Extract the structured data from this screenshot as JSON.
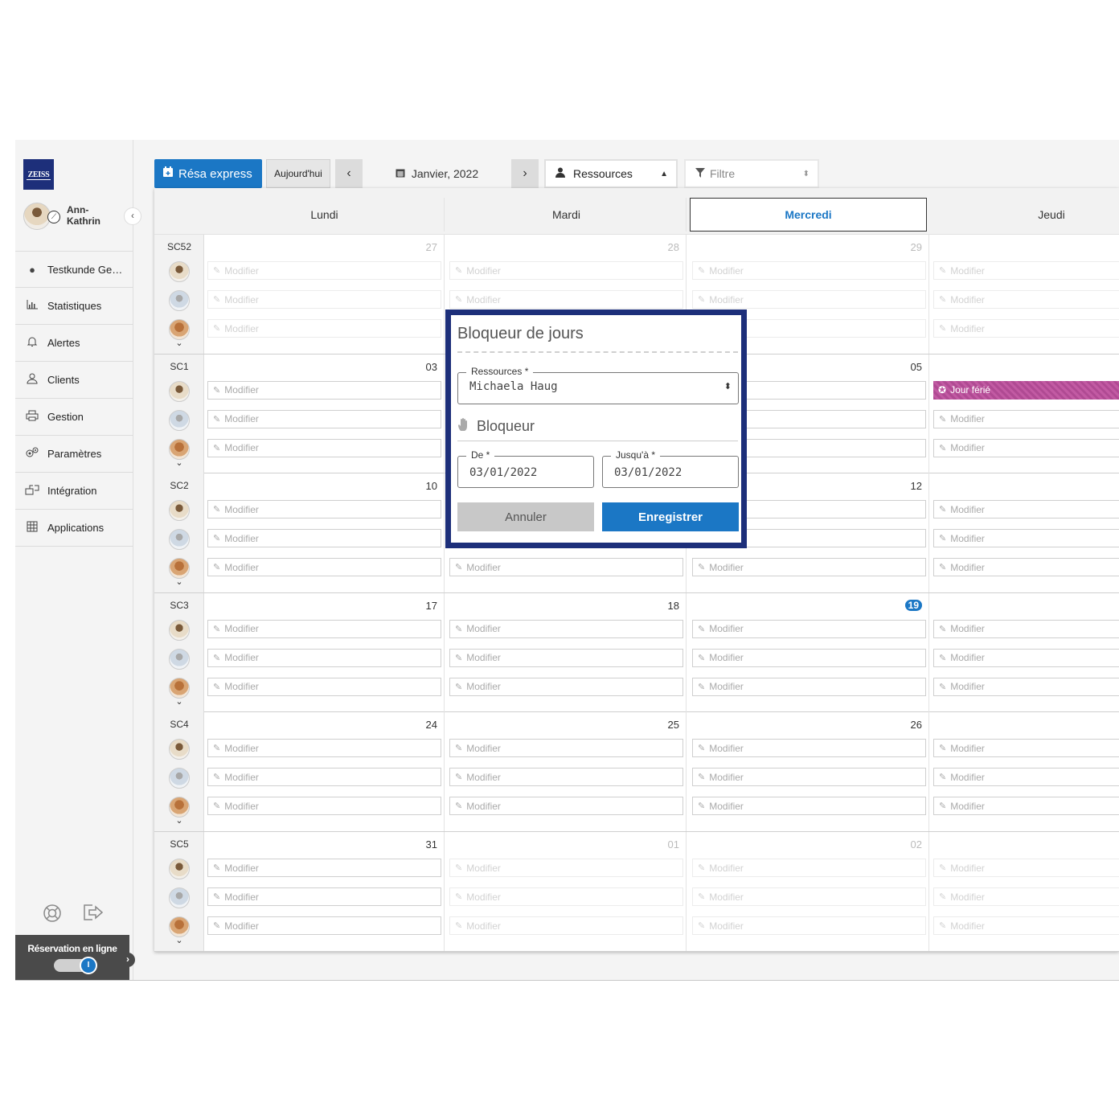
{
  "brand": {
    "logo_text": "ZEISS"
  },
  "user": {
    "name": "Ann-\nKathrin"
  },
  "sidebar": {
    "items": [
      {
        "label": "Testkunde Ger…",
        "icon": "dark-circle-icon"
      },
      {
        "label": "Statistiques",
        "icon": "bar-chart-icon"
      },
      {
        "label": "Alertes",
        "icon": "bell-icon"
      },
      {
        "label": "Clients",
        "icon": "user-icon"
      },
      {
        "label": "Gestion",
        "icon": "printer-icon"
      },
      {
        "label": "Paramètres",
        "icon": "gears-icon"
      },
      {
        "label": "Intégration",
        "icon": "integration-icon"
      },
      {
        "label": "Applications",
        "icon": "grid-icon"
      }
    ],
    "online_booking_label": "Réservation en ligne",
    "online_booking_enabled": true
  },
  "toolbar": {
    "resa_label": "Résa express",
    "today_label": "Aujourd'hui",
    "month_label": "Janvier, 2022",
    "resources_label": "Ressources",
    "filter_placeholder": "Filtre"
  },
  "calendar": {
    "days": [
      "Lundi",
      "Mardi",
      "Mercredi",
      "Jeudi"
    ],
    "active_day": "Mercredi",
    "modifier_label": "Modifier",
    "holiday_label": "Jour férié",
    "weeks": [
      {
        "label": "SC52",
        "dates": [
          "27",
          "28",
          "29",
          ""
        ]
      },
      {
        "label": "SC1",
        "dates": [
          "03",
          "",
          "05",
          ""
        ]
      },
      {
        "label": "SC2",
        "dates": [
          "10",
          "",
          "12",
          ""
        ]
      },
      {
        "label": "SC3",
        "dates": [
          "17",
          "18",
          "19",
          ""
        ]
      },
      {
        "label": "SC4",
        "dates": [
          "24",
          "25",
          "26",
          ""
        ]
      },
      {
        "label": "SC5",
        "dates": [
          "31",
          "01",
          "02",
          ""
        ]
      }
    ],
    "today_date": "19"
  },
  "modal": {
    "title": "Bloqueur de jours",
    "resources_legend": "Ressources *",
    "resources_value": "Michaela Haug",
    "bloqueur_label": "Bloqueur",
    "from_legend": "De *",
    "from_value": "03/01/2022",
    "to_legend": "Jusqu'à *",
    "to_value": "03/01/2022",
    "cancel_label": "Annuler",
    "save_label": "Enregistrer"
  },
  "colors": {
    "accent": "#1b77c5",
    "modal_border": "#1d2f7a",
    "holiday": "#b04a93"
  }
}
